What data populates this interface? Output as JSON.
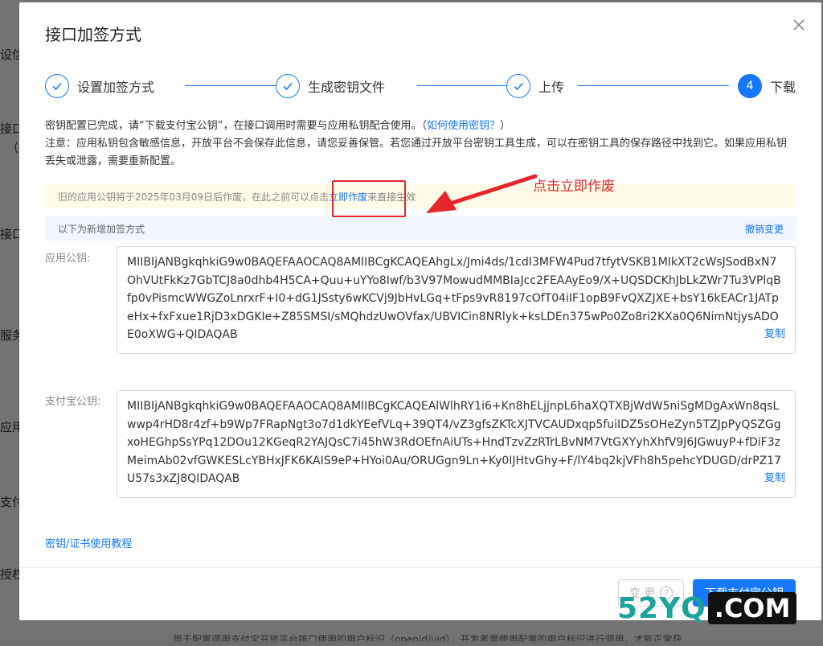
{
  "background": {
    "fragments": [
      "设信",
      "接口",
      "（密",
      "接口",
      "服务",
      "应用",
      "支付",
      "授权"
    ],
    "bottom_text": "用于配置调用支付宝开放平台接口使用的用户标识（openid/uid），开发者需使用配置的用户标识进行调用，才能正常获"
  },
  "modal": {
    "title": "接口加签方式",
    "close_icon": "close-icon",
    "steps": [
      {
        "label": "设置加签方式",
        "status": "done"
      },
      {
        "label": "生成密钥文件",
        "status": "done"
      },
      {
        "label": "上传",
        "status": "done"
      },
      {
        "label": "下载",
        "status": "active",
        "number": "4"
      }
    ],
    "info": {
      "line1": "密钥配置已完成，请“下载支付宝公钥”，在接口调用时需要与应用私钥配合使用。（",
      "line1_link": "如何使用密钥？",
      "line1_end": "）",
      "note": "注意：应用私钥包含敏感信息，开放平台不会保存此信息，请您妥善保管。若您通过开放平台密钥工具生成，可以在密钥工具的保存路径中找到它。如果应用私钥丢失或泄露，需要重新配置。"
    },
    "notice": {
      "before": "旧的应用公钥将于2025年03月09日后作废，在此之前可以点击",
      "link": "立即作废",
      "after": "来直接生效"
    },
    "subbar": {
      "text": "以下为新增加签方式",
      "revert": "撤销变更"
    },
    "app_public_key": {
      "label": "应用公钥:",
      "value": "MIIBIjANBgkqhkiG9w0BAQEFAAOCAQ8AMIIBCgKCAQEAhgLx/Jmi4ds/1cdI3MFW4Pud7tfytVSKB1MIkXT2cWsJSodBxN7OhVUtFkKz7GbTCJ8a0dhb4H5CA+Quu+uYYo8Iwf/b3V97MowudMMBIaJcc2FEAAyEo9/X+UQSDCKhJbLkZWr7Tu3VPlqBfp0vPismcWWGZoLnrxrF+I0+dG1JSsty6wKCVj9JbHvLGq+tFps9vR8197cOfT04iIF1opB9FvQXZJXE+bsY16kEACr1JATpeHx+fxFxue1RjD3xDGKIe+Z85SMSI/sMQhdzUwOVfax/UBVICin8NRlyk+ksLDEn375wPo0Zo8ri2KXa0Q6NimNtjysADOE0oXWG+QIDAQAB",
      "copy": "复制"
    },
    "alipay_public_key": {
      "label": "支付宝公钥:",
      "value": "MIIBIjANBgkqhkiG9w0BAQEFAAOCAQ8AMIIBCgKCAQEAlWlhRY1i6+Kn8hELjjnpL6haXQTXBjWdW5niSgMDgAxWn8qsLwwp4rHD8r4zf+b9Wp7FRapNgt3o7d1dkYEefVLq+39QT4/vZ3gfsZKTcXJTVCAUDxqp5fuiIDZ5sOHeZyn5TZJpPyQSZGgxoHEGhpSsYPq12DOu12KGeqR2YAJQsC7i45hW3RdOEfnAiUTs+HndTzvZzRTrLBvNM7VtGXYyhXhfV9J6JGwuyP+fDiF3zMeimAb02vfGWKESLcYBHxJFK6KAIS9eP+HYoi0Au/ORUGgn9Ln+Ky0IJHtvGhy+F/lY4bq2kjVFh8h5pehcYDUGD/drPZ17U57s3xZJ8QIDAQAB",
      "copy": "复制"
    },
    "tutorial_link": "密钥/证书使用教程",
    "footer": {
      "change_button": "变 更",
      "download_button": "下载支付宝公钥"
    }
  },
  "annotation": {
    "text": "点击立即作废",
    "color": "#e5262b"
  },
  "watermark": {
    "left": "52YQ",
    "right": ".COM"
  },
  "colors": {
    "primary": "#1677ff",
    "notice_bg": "#fffbe6",
    "subbar_bg": "#f0f5ff"
  }
}
